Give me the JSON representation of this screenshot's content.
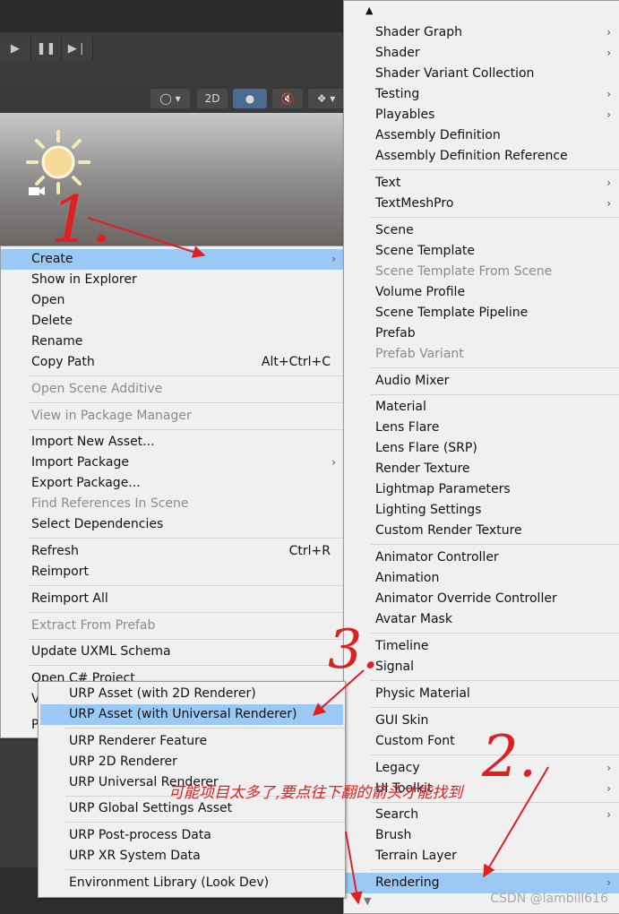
{
  "editor": {
    "toolbar_2d_label": "2D",
    "play_icons": [
      "play-icon",
      "pause-icon",
      "step-icon"
    ]
  },
  "left_menu": {
    "items": [
      {
        "label": "Create",
        "arrow": true,
        "selected": true
      },
      {
        "label": "Show in Explorer"
      },
      {
        "label": "Open"
      },
      {
        "label": "Delete"
      },
      {
        "label": "Rename"
      },
      {
        "label": "Copy Path",
        "shortcut": "Alt+Ctrl+C"
      },
      {
        "label": "Open Scene Additive",
        "disabled": true
      },
      {
        "label": "View in Package Manager",
        "disabled": true
      },
      {
        "label": "Import New Asset..."
      },
      {
        "label": "Import Package",
        "arrow": true
      },
      {
        "label": "Export Package..."
      },
      {
        "label": "Find References In Scene",
        "disabled": true
      },
      {
        "label": "Select Dependencies"
      },
      {
        "label": "Refresh",
        "shortcut": "Ctrl+R"
      },
      {
        "label": "Reimport"
      },
      {
        "label": "Reimport All"
      },
      {
        "label": "Extract From Prefab",
        "disabled": true
      },
      {
        "label": "Update UXML Schema"
      },
      {
        "label": "Open C# Project"
      },
      {
        "label": "V"
      },
      {
        "label": "P"
      }
    ]
  },
  "create_menu": {
    "items": [
      {
        "label": "Shader Graph",
        "arrow": true
      },
      {
        "label": "Shader",
        "arrow": true
      },
      {
        "label": "Shader Variant Collection"
      },
      {
        "label": "Testing",
        "arrow": true
      },
      {
        "label": "Playables",
        "arrow": true
      },
      {
        "label": "Assembly Definition"
      },
      {
        "label": "Assembly Definition Reference"
      },
      {
        "label": "Text",
        "arrow": true
      },
      {
        "label": "TextMeshPro",
        "arrow": true
      },
      {
        "label": "Scene"
      },
      {
        "label": "Scene Template"
      },
      {
        "label": "Scene Template From Scene",
        "disabled": true
      },
      {
        "label": "Volume Profile"
      },
      {
        "label": "Scene Template Pipeline"
      },
      {
        "label": "Prefab"
      },
      {
        "label": "Prefab Variant",
        "disabled": true
      },
      {
        "label": "Audio Mixer"
      },
      {
        "label": "Material"
      },
      {
        "label": "Lens Flare"
      },
      {
        "label": "Lens Flare (SRP)"
      },
      {
        "label": "Render Texture"
      },
      {
        "label": "Lightmap Parameters"
      },
      {
        "label": "Lighting Settings"
      },
      {
        "label": "Custom Render Texture"
      },
      {
        "label": "Animator Controller"
      },
      {
        "label": "Animation"
      },
      {
        "label": "Animator Override Controller"
      },
      {
        "label": "Avatar Mask"
      },
      {
        "label": "Timeline"
      },
      {
        "label": "Signal"
      },
      {
        "label": "Physic Material"
      },
      {
        "label": "GUI Skin"
      },
      {
        "label": "Custom Font"
      },
      {
        "label": "Legacy",
        "arrow": true
      },
      {
        "label": "UI Toolkit",
        "arrow": true
      },
      {
        "label": "Search",
        "arrow": true
      },
      {
        "label": "Brush"
      },
      {
        "label": "Terrain Layer"
      },
      {
        "label": "Rendering",
        "arrow": true,
        "selected": true
      }
    ]
  },
  "rendering_menu": {
    "items": [
      {
        "label": "URP Asset (with 2D Renderer)"
      },
      {
        "label": "URP Asset (with Universal Renderer)",
        "selected": true
      },
      {
        "label": "URP Renderer Feature"
      },
      {
        "label": "URP 2D Renderer"
      },
      {
        "label": "URP Universal Renderer"
      },
      {
        "label": "URP Global Settings Asset"
      },
      {
        "label": "URP Post-process Data"
      },
      {
        "label": "URP XR System Data"
      },
      {
        "label": "Environment Library (Look Dev)"
      }
    ]
  },
  "annotations": {
    "step1": "1.",
    "step2": "2.",
    "step3": "3.",
    "note": "可能项目太多了,要点往下翻的箭头才能找到",
    "color": "#e02020"
  },
  "watermark": "CSDN @lambill616"
}
